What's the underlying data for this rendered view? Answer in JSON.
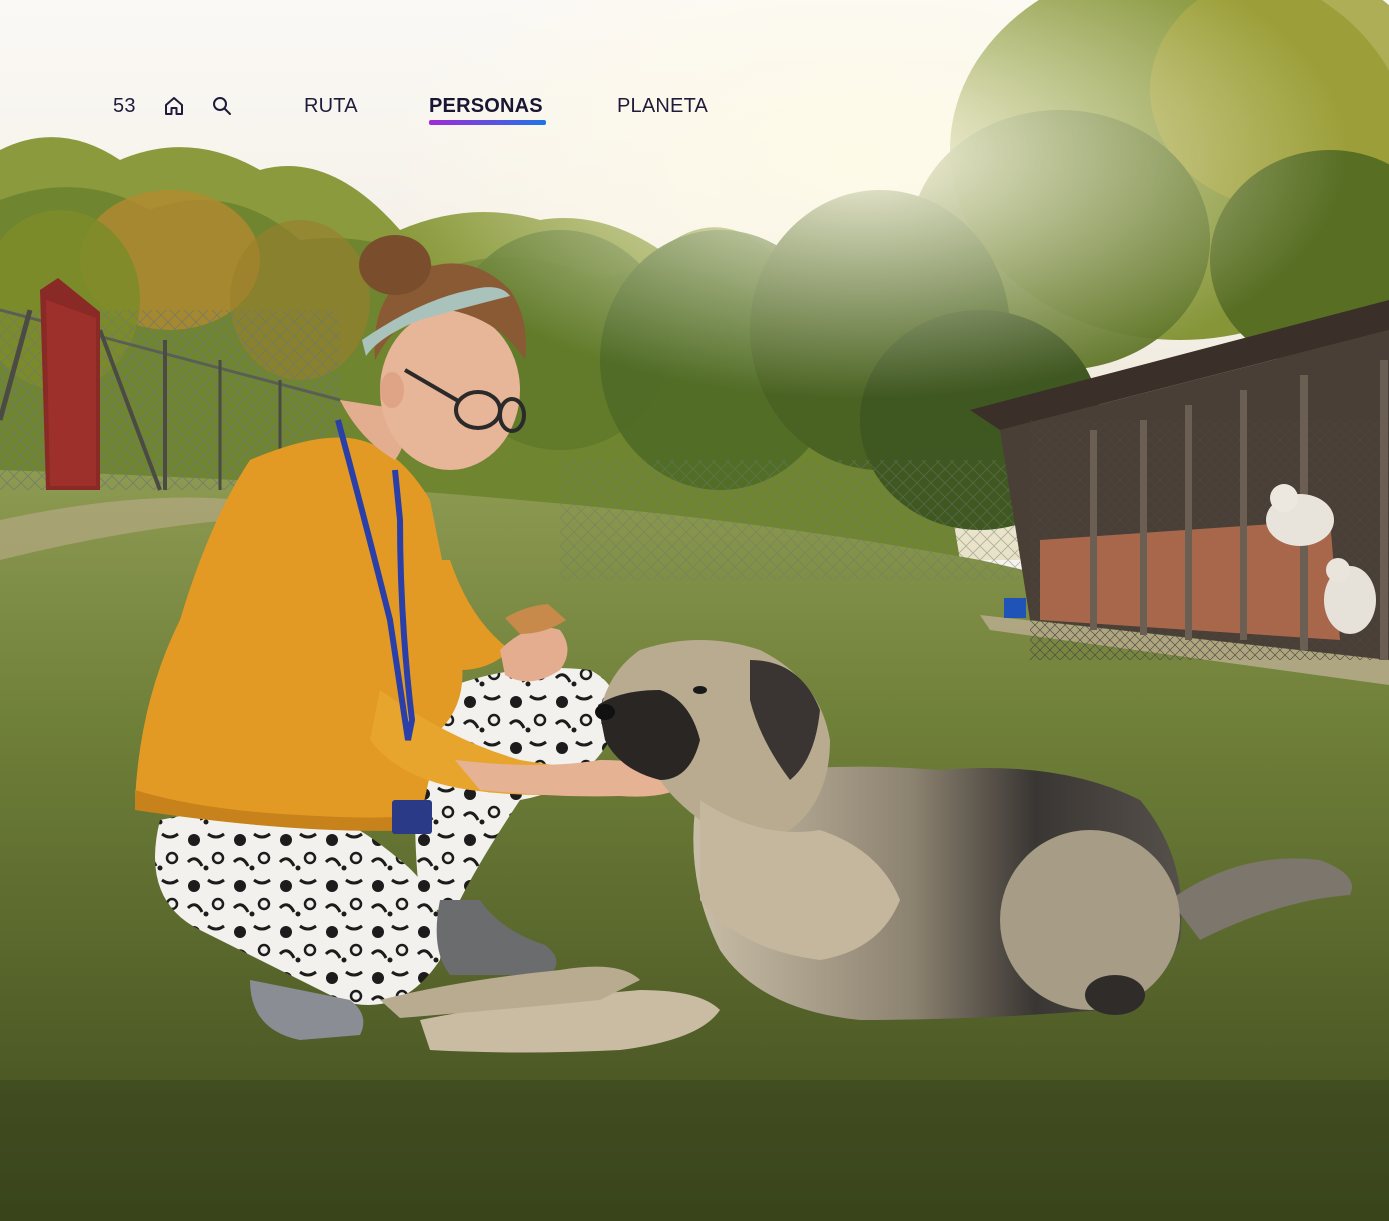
{
  "page": {
    "number": "53"
  },
  "nav": {
    "home_icon": "home-icon",
    "search_icon": "search-icon",
    "tabs": [
      {
        "label": "RUTA",
        "active": false
      },
      {
        "label": "PERSONAS",
        "active": true
      },
      {
        "label": "PLANETA",
        "active": false
      }
    ]
  },
  "colors": {
    "nav_text": "#1f1b3a",
    "underline_start": "#a12ad8",
    "underline_end": "#1e74e6",
    "sky": "#f6f3ee",
    "grass": "#5d6f2e",
    "sweater": "#e39a24"
  }
}
